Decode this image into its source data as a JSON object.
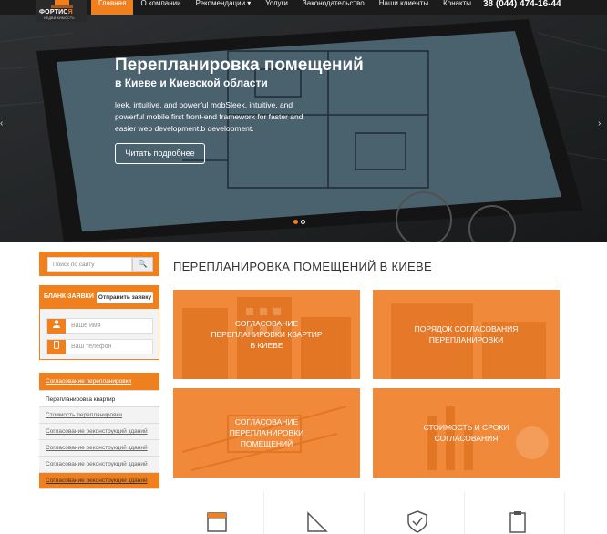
{
  "logo": {
    "name_main": "ФОРТИС",
    "name_accent": "Я",
    "tagline": "НЕДВИЖИМОСТЬ"
  },
  "nav": {
    "items": [
      "Главная",
      "О компании",
      "Рекомендации ▾",
      "Услуги",
      "Законодательство",
      "Наши клиенты",
      "Конакты"
    ],
    "phone": "38 (044) 474-16-44"
  },
  "hero": {
    "title": "Перепланировка помещений",
    "subtitle": "в Киеве и Киевской области",
    "text": "leek, intuitive, and powerful mobSleek, intuitive, and powerful mobile first front-end framework for faster and easier web development.b development.",
    "button": "Читать подробнее",
    "prev_arrow": "‹",
    "next_arrow": "›"
  },
  "sidebar": {
    "search_placeholder": "Поиск по сайту",
    "search_icon": "search-icon",
    "search_glyph": "🔍",
    "form": {
      "title": "БЛАНК ЗАЯВКИ",
      "button": "Отправить заявку",
      "name_placeholder": "Ваше имя",
      "phone_placeholder": "Ваш телефон"
    },
    "menu": [
      "Согласование перепланировки",
      "Перепланировка квартир",
      "Стоимость перепланировки",
      "Согласование реконструкций зданий",
      "Согласование реконструкций зданий",
      "Согласование реконструкций зданий",
      "Согласование реконструкций зданий"
    ]
  },
  "main": {
    "title": "ПЕРЕПЛАНИРОВКА ПОМЕЩЕНИЙ В КИЕВЕ",
    "tiles": [
      "Согласование перепланировки квартир в Киеве",
      "Порядок согласования перепланировки",
      "Согласование перепланировки помещений",
      "Стоимость и сроки согласования"
    ]
  },
  "colors": {
    "accent": "#f07f1e",
    "dark": "#1b1b1b"
  }
}
